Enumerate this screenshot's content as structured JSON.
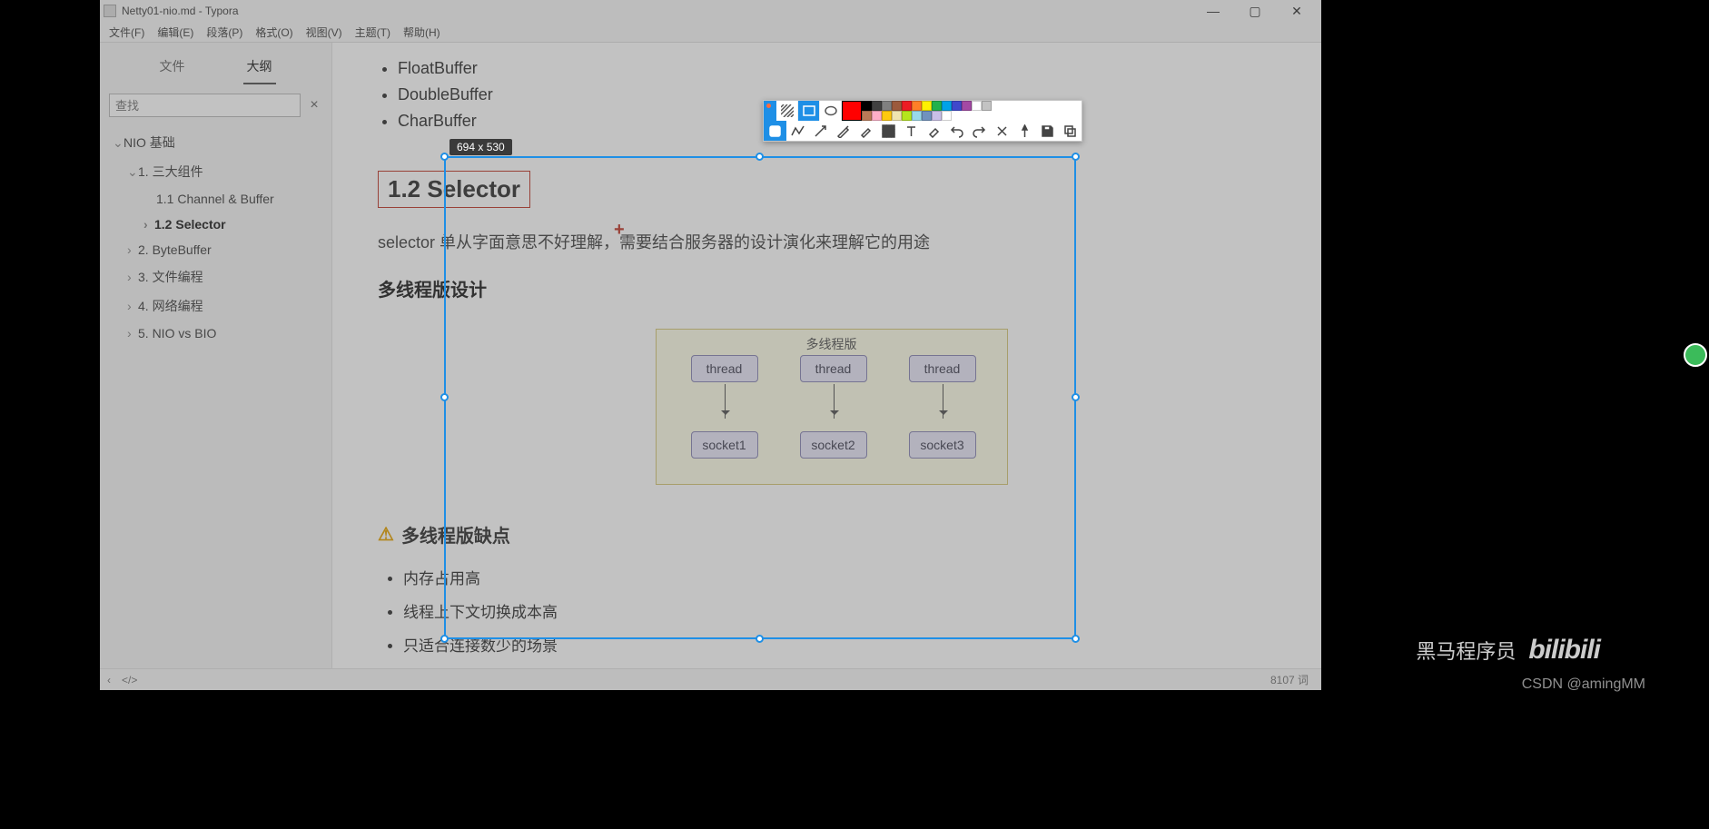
{
  "title": "Netty01-nio.md - Typora",
  "menu": [
    "文件(F)",
    "编辑(E)",
    "段落(P)",
    "格式(O)",
    "视图(V)",
    "主题(T)",
    "帮助(H)"
  ],
  "sidebar": {
    "tab_file": "文件",
    "tab_outline": "大纲",
    "search_placeholder": "查找",
    "items": [
      {
        "label": "NIO 基础",
        "lvl": 1,
        "open": true
      },
      {
        "label": "1. 三大组件",
        "lvl": 2,
        "open": true
      },
      {
        "label": "1.1 Channel & Buffer",
        "lvl": 3
      },
      {
        "label": "1.2 Selector",
        "lvl": 3,
        "bold": true,
        "caret": true
      },
      {
        "label": "2. ByteBuffer",
        "lvl": 2,
        "caret": true
      },
      {
        "label": "3. 文件编程",
        "lvl": 2,
        "caret": true
      },
      {
        "label": "4. 网络编程",
        "lvl": 2,
        "caret": true
      },
      {
        "label": "5. NIO vs BIO",
        "lvl": 2,
        "caret": true
      }
    ]
  },
  "doc": {
    "top_list": [
      "FloatBuffer",
      "DoubleBuffer",
      "CharBuffer"
    ],
    "h2": "1.2 Selector",
    "para": "selector 单从字面意思不好理解，需要结合服务器的设计演化来理解它的用途",
    "h3a": "多线程版设计",
    "diagram": {
      "title": "多线程版",
      "threads": [
        "thread",
        "thread",
        "thread"
      ],
      "sockets": [
        "socket1",
        "socket2",
        "socket3"
      ]
    },
    "h3b": "多线程版缺点",
    "bullets": [
      "内存占用高",
      "线程上下文切换成本高",
      "只适合连接数少的场景"
    ]
  },
  "selection_dims": "694 x 530",
  "status_words": "8107 词",
  "snip": {
    "current_color": "#ff0000",
    "palette": [
      "#000000",
      "#404040",
      "#808080",
      "#9c5a3c",
      "#ed1c24",
      "#ff7f27",
      "#fff200",
      "#22b14c",
      "#00a2e8",
      "#3f48cc",
      "#a349a4",
      "#ffffff",
      "#c3c3c3",
      "#b97a57",
      "#ffaec9",
      "#ffc90e",
      "#efe4b0",
      "#b5e61d",
      "#99d9ea",
      "#7092be",
      "#c8bfe7",
      "#ffffff"
    ]
  },
  "watermark1": "黑马程序员",
  "watermark1b": "bilibili",
  "watermark2": "CSDN @amingMM"
}
